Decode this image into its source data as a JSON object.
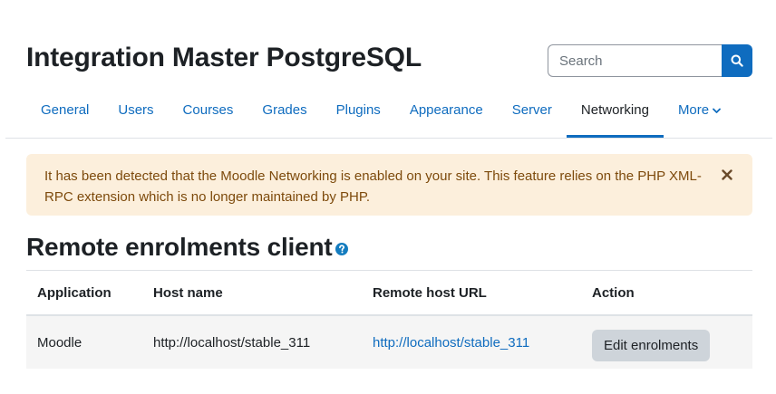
{
  "header": {
    "site_title": "Integration Master PostgreSQL",
    "search": {
      "placeholder": "Search",
      "button_icon": "search-icon"
    }
  },
  "nav": {
    "tabs": [
      {
        "label": "General",
        "active": false
      },
      {
        "label": "Users",
        "active": false
      },
      {
        "label": "Courses",
        "active": false
      },
      {
        "label": "Grades",
        "active": false
      },
      {
        "label": "Plugins",
        "active": false
      },
      {
        "label": "Appearance",
        "active": false
      },
      {
        "label": "Server",
        "active": false
      },
      {
        "label": "Networking",
        "active": true
      }
    ],
    "more_label": "More",
    "more_icon": "chevron-down-icon"
  },
  "alert": {
    "message": "It has been detected that the Moodle Networking is enabled on your site. This feature relies on the PHP XML-RPC extension which is no longer maintained by PHP.",
    "close_icon": "close-icon"
  },
  "page": {
    "title": "Remote enrolments client",
    "help_icon": "question-circle-icon"
  },
  "table": {
    "headers": [
      "Application",
      "Host name",
      "Remote host URL",
      "Action"
    ],
    "rows": [
      {
        "application": "Moodle",
        "host_name": "http://localhost/stable_311",
        "remote_url": "http://localhost/stable_311",
        "action_label": "Edit enrolments"
      }
    ]
  },
  "colors": {
    "primary": "#0f6cbf",
    "alert_bg": "#fcefdc",
    "alert_text": "#7d4a0c",
    "help_icon": "#147cbf"
  }
}
